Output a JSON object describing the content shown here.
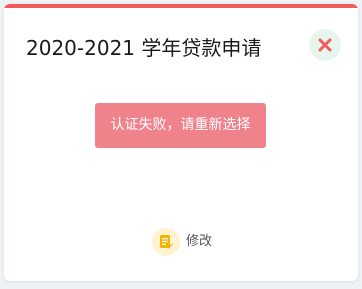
{
  "dialog": {
    "title": "2020-2021 学年贷款申请",
    "close_icon": "close-icon",
    "accent_color": "#f15b5b"
  },
  "status_button": {
    "label": "认证失败，请重新选择",
    "background_color": "#f0828c"
  },
  "edit_action": {
    "label": "修改",
    "icon": "edit-document-icon",
    "icon_background": "#fff3cf",
    "icon_color": "#f5b400"
  }
}
